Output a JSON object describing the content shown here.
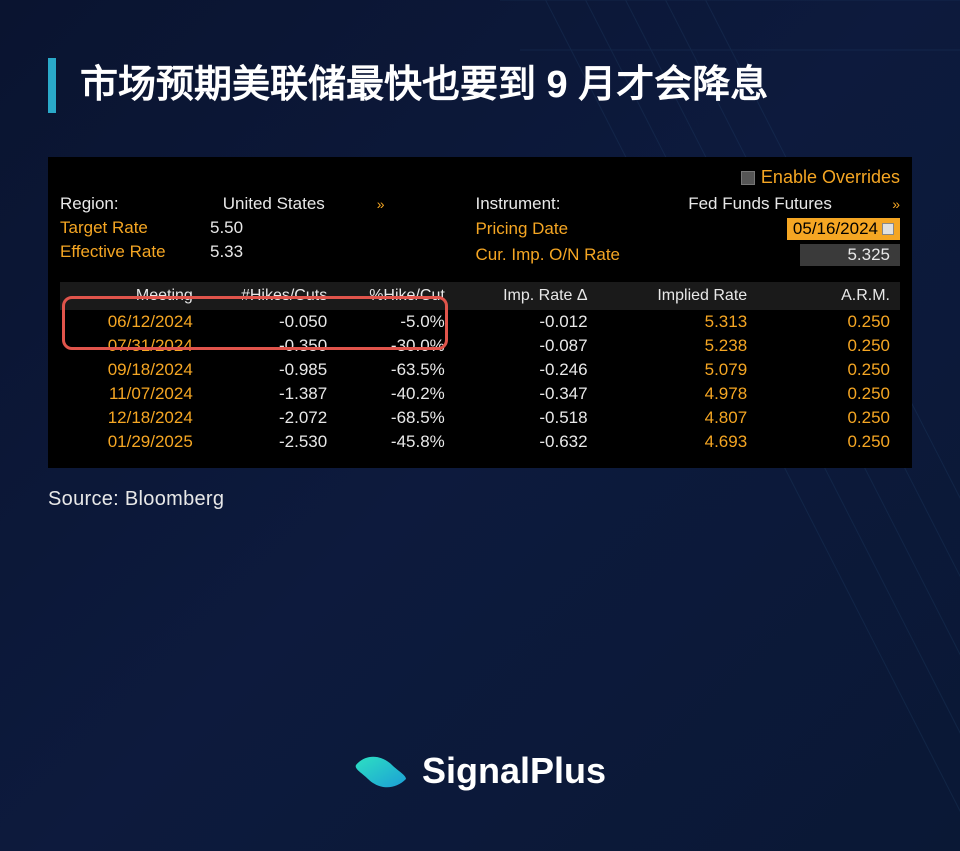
{
  "title": "市场预期美联储最快也要到 9 月才会降息",
  "source": "Source: Bloomberg",
  "brand": "SignalPlus",
  "terminal": {
    "enable_overrides": "Enable Overrides",
    "region_label": "Region:",
    "region_value": "United States",
    "target_rate_label": "Target Rate",
    "target_rate_value": "5.50",
    "effective_rate_label": "Effective Rate",
    "effective_rate_value": "5.33",
    "instrument_label": "Instrument:",
    "instrument_value": "Fed Funds Futures",
    "pricing_date_label": "Pricing Date",
    "pricing_date_value": "05/16/2024",
    "cur_rate_label": "Cur. Imp. O/N Rate",
    "cur_rate_value": "5.325",
    "headers": {
      "meeting": "Meeting",
      "hikes_cuts": "#Hikes/Cuts",
      "pct_hike_cut": "%Hike/Cut",
      "imp_rate_delta": "Imp. Rate Δ",
      "implied_rate": "Implied Rate",
      "arm": "A.R.M."
    },
    "rows": [
      {
        "meeting": "06/12/2024",
        "hikes_cuts": "-0.050",
        "pct_hike_cut": "-5.0%",
        "imp_rate_delta": "-0.012",
        "implied_rate": "5.313",
        "arm": "0.250"
      },
      {
        "meeting": "07/31/2024",
        "hikes_cuts": "-0.350",
        "pct_hike_cut": "-30.0%",
        "imp_rate_delta": "-0.087",
        "implied_rate": "5.238",
        "arm": "0.250"
      },
      {
        "meeting": "09/18/2024",
        "hikes_cuts": "-0.985",
        "pct_hike_cut": "-63.5%",
        "imp_rate_delta": "-0.246",
        "implied_rate": "5.079",
        "arm": "0.250"
      },
      {
        "meeting": "11/07/2024",
        "hikes_cuts": "-1.387",
        "pct_hike_cut": "-40.2%",
        "imp_rate_delta": "-0.347",
        "implied_rate": "4.978",
        "arm": "0.250"
      },
      {
        "meeting": "12/18/2024",
        "hikes_cuts": "-2.072",
        "pct_hike_cut": "-68.5%",
        "imp_rate_delta": "-0.518",
        "implied_rate": "4.807",
        "arm": "0.250"
      },
      {
        "meeting": "01/29/2025",
        "hikes_cuts": "-2.530",
        "pct_hike_cut": "-45.8%",
        "imp_rate_delta": "-0.632",
        "implied_rate": "4.693",
        "arm": "0.250"
      }
    ]
  }
}
